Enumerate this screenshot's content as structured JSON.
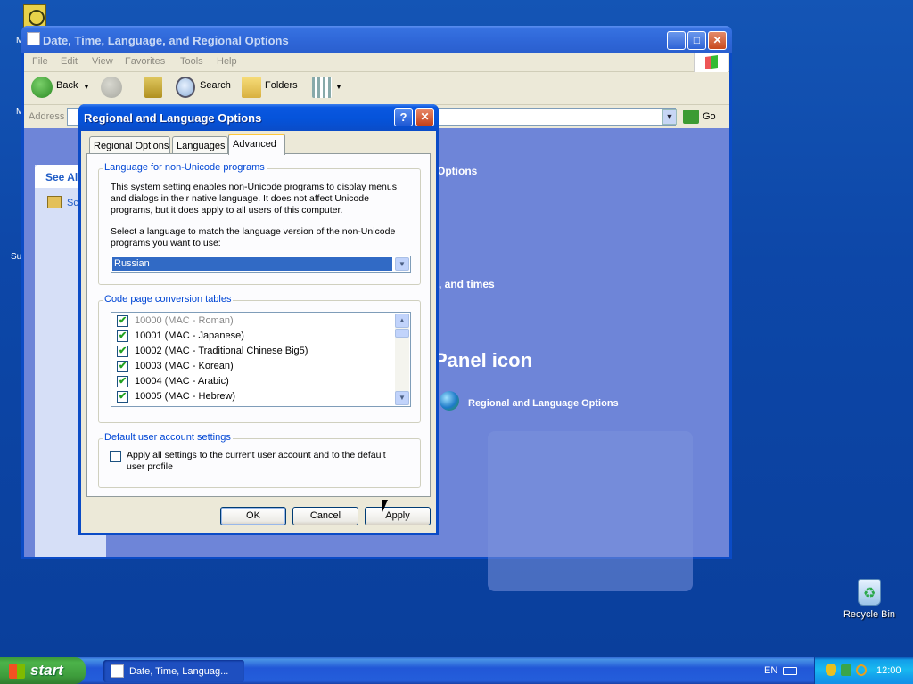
{
  "explorer": {
    "title": "Date, Time, Language, and Regional Options",
    "menu": [
      "File",
      "Edit",
      "View",
      "Favorites",
      "Tools",
      "Help"
    ],
    "toolbar": {
      "back": "Back",
      "search": "Search",
      "folders": "Folders"
    },
    "address_label": "Address",
    "go_label": "Go",
    "left_pane_header": "See Al",
    "left_pane_item": "Sc",
    "right_fragment_1": "Options",
    "right_fragment_2": ", and times",
    "right_heading": "Panel icon",
    "right_link": "Regional and Language Options"
  },
  "dialog": {
    "title": "Regional and Language Options",
    "help_glyph": "?",
    "close_glyph": "✕",
    "tabs": [
      "Regional Options",
      "Languages",
      "Advanced"
    ],
    "active_tab": "Advanced",
    "group1": {
      "label": "Language for non-Unicode programs",
      "desc_lines": [
        "This system setting enables non-Unicode programs to display menus",
        "and dialogs in their native language. It does not affect Unicode",
        "programs, but it does apply to all users of this computer."
      ],
      "prompt_lines": [
        "Select a language to match the language version of the non-Unicode",
        "programs you want to use:"
      ],
      "selected_language": "Russian"
    },
    "group2": {
      "label": "Code page conversion tables",
      "items": [
        {
          "text": "10000 (MAC - Roman)",
          "checked": true,
          "disabled": true
        },
        {
          "text": "10001 (MAC - Japanese)",
          "checked": true,
          "disabled": false
        },
        {
          "text": "10002 (MAC - Traditional Chinese Big5)",
          "checked": true,
          "disabled": false
        },
        {
          "text": "10003 (MAC - Korean)",
          "checked": true,
          "disabled": false
        },
        {
          "text": "10004 (MAC - Arabic)",
          "checked": true,
          "disabled": false
        },
        {
          "text": "10005 (MAC - Hebrew)",
          "checked": true,
          "disabled": false
        }
      ]
    },
    "group3": {
      "label": "Default user account settings",
      "checkbox_lines": [
        "Apply all settings to the current user account and to the default",
        "user profile"
      ],
      "checked": false
    },
    "buttons": {
      "ok": "OK",
      "cancel": "Cancel",
      "apply": "Apply"
    }
  },
  "desktop": {
    "recycle_bin": "Recycle Bin"
  },
  "taskbar": {
    "start": "start",
    "task": "Date, Time, Languag...",
    "language": "EN",
    "clock": "12:00"
  }
}
